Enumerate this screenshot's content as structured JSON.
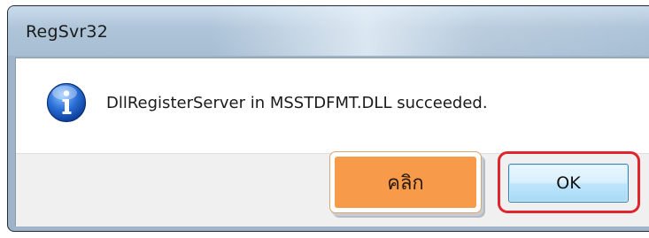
{
  "window": {
    "title": "RegSvr32"
  },
  "message": {
    "icon": "info-icon",
    "text": "DllRegisterServer in MSSTDFMT.DLL succeeded."
  },
  "callout": {
    "label": "คลิก",
    "color": "#f79a49"
  },
  "buttons": {
    "ok_label": "OK"
  },
  "highlight": {
    "color": "#e1252d"
  }
}
